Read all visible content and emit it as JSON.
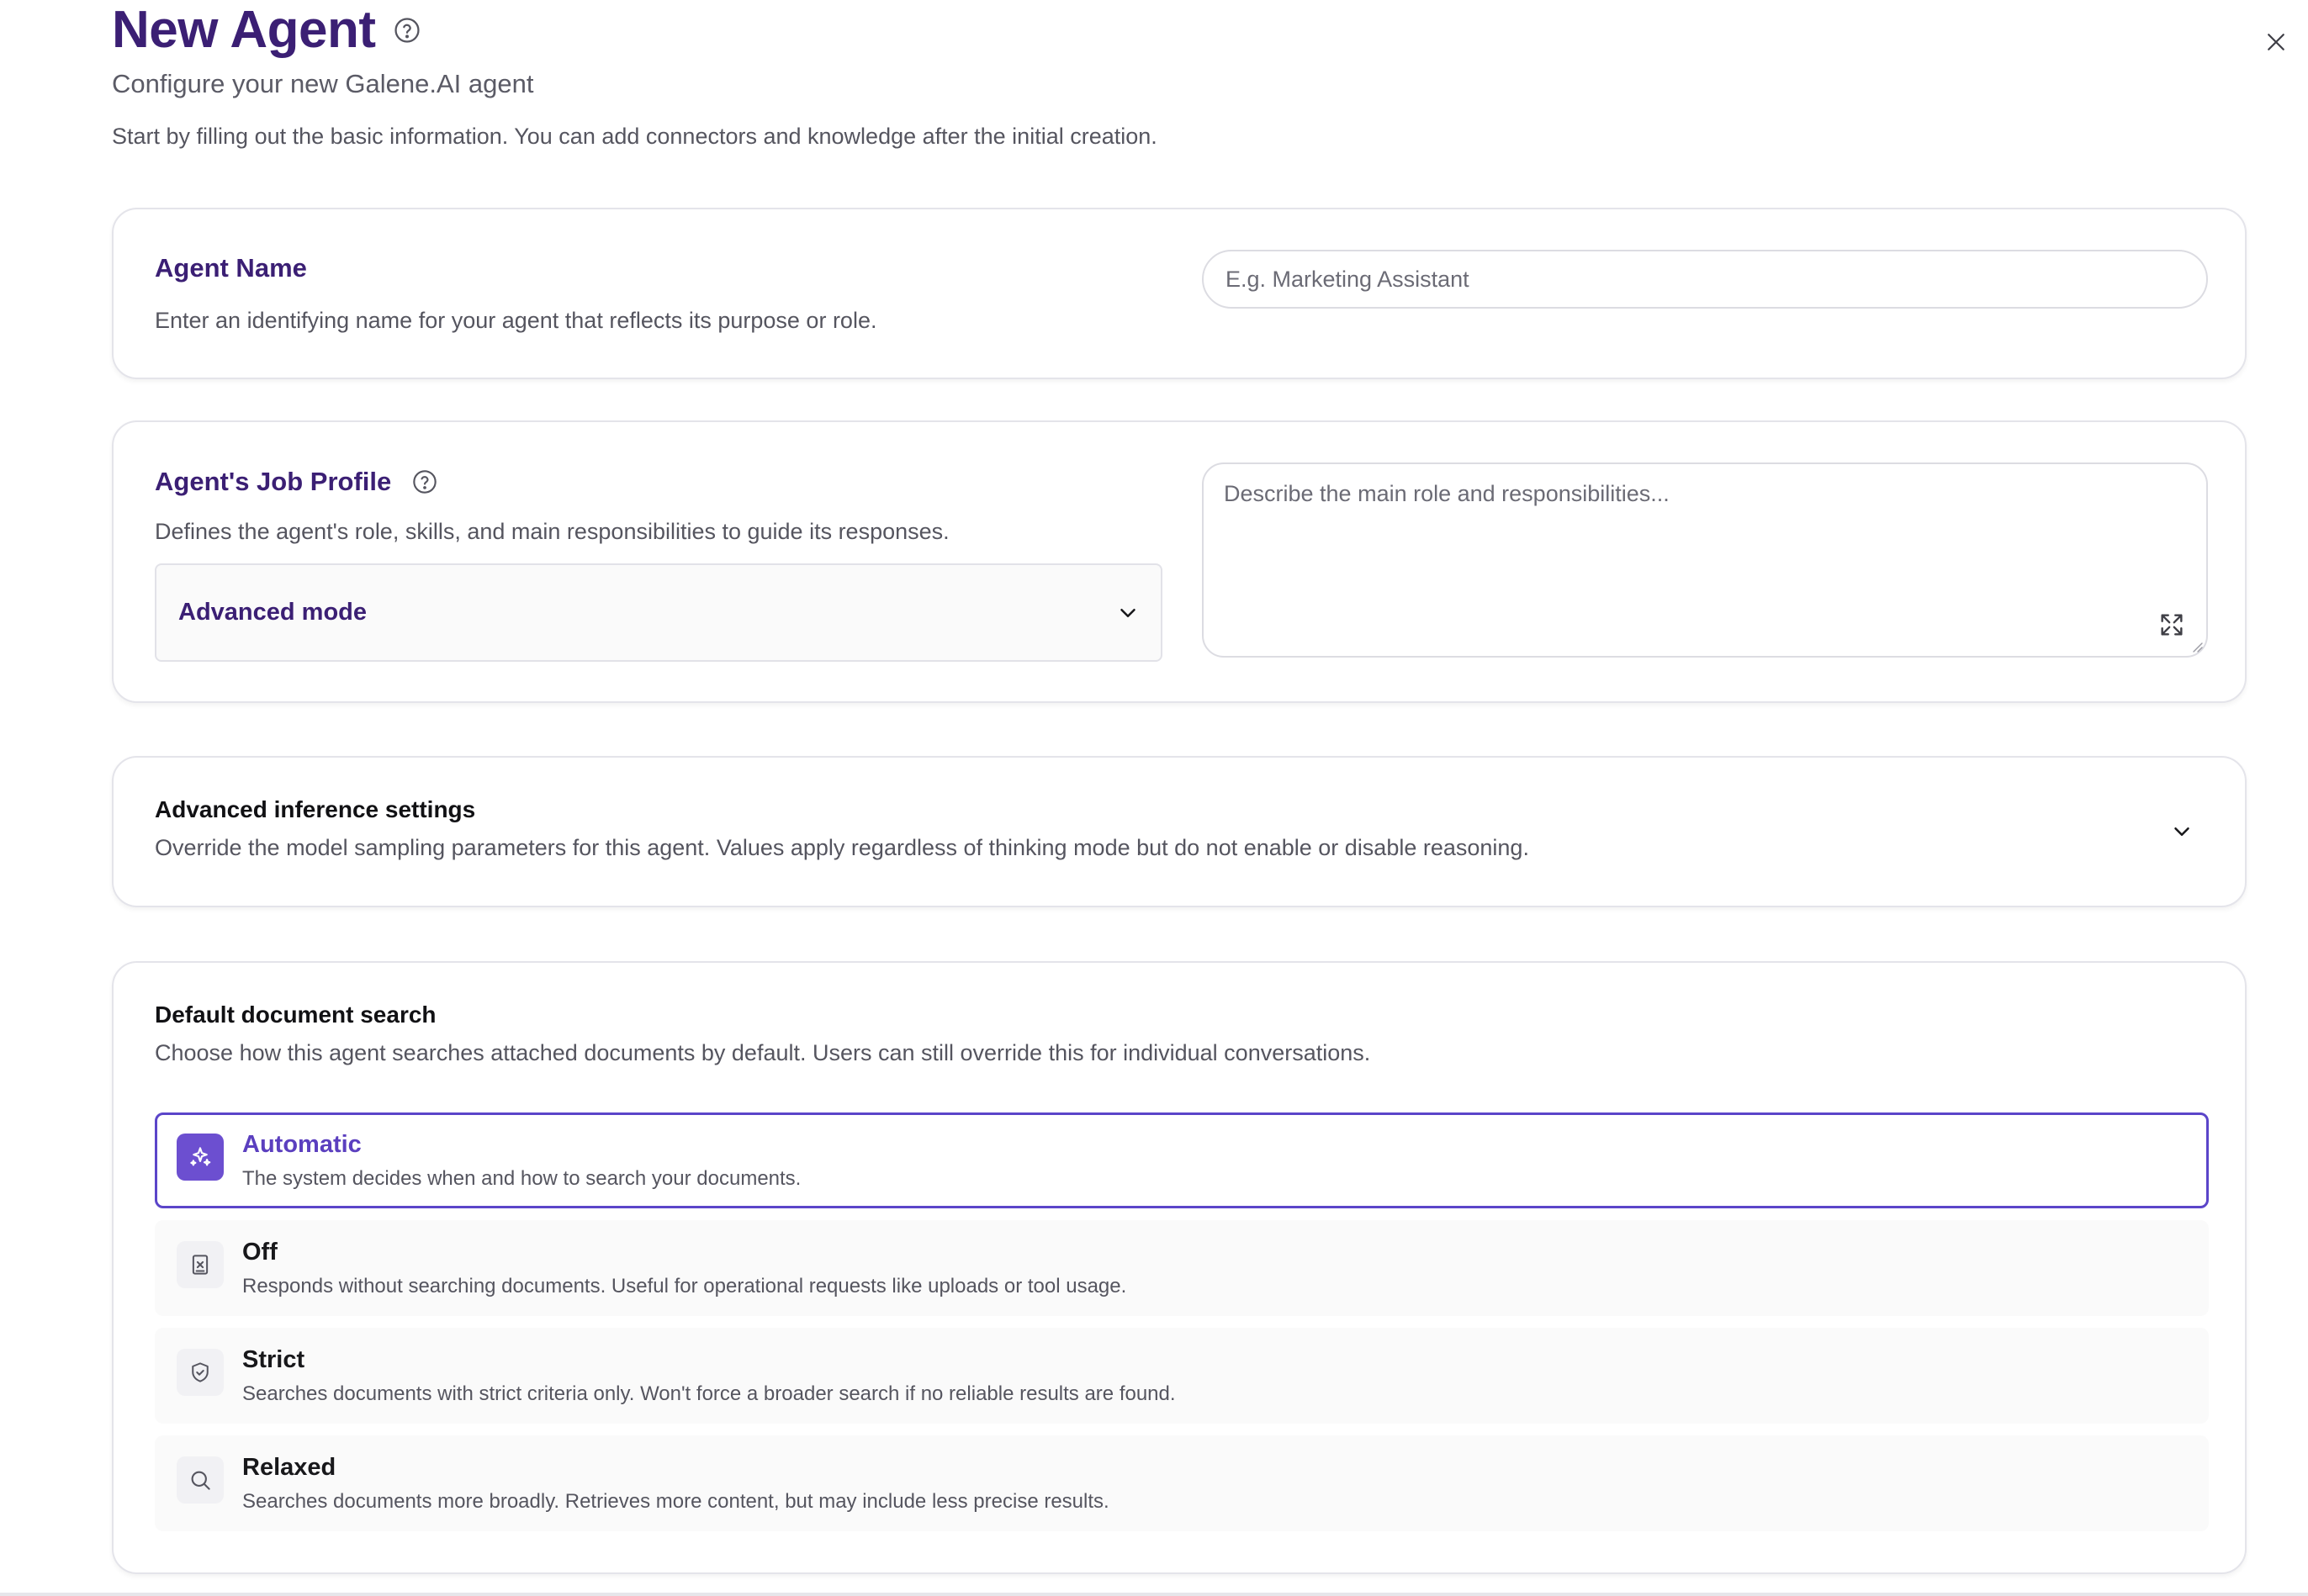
{
  "header": {
    "title": "New Agent",
    "subtitle": "Configure your new Galene.AI agent",
    "intro": "Start by filling out the basic information. You can add connectors and knowledge after the initial creation."
  },
  "agent_name": {
    "title": "Agent Name",
    "description": "Enter an identifying name for your agent that reflects its purpose or role.",
    "input_value": "",
    "input_placeholder": "E.g. Marketing Assistant"
  },
  "job_profile": {
    "title": "Agent's Job Profile",
    "description": "Defines the agent's role, skills, and main responsibilities to guide its responses.",
    "mode_selected": "Advanced mode",
    "textarea_value": "",
    "textarea_placeholder": "Describe the main role and responsibilities..."
  },
  "inference": {
    "title": "Advanced inference settings",
    "description": "Override the model sampling parameters for this agent. Values apply regardless of thinking mode but do not enable or disable reasoning.",
    "expanded": false
  },
  "document_search": {
    "title": "Default document search",
    "description": "Choose how this agent searches attached documents by default. Users can still override this for individual conversations.",
    "selected": "Automatic",
    "options": [
      {
        "title": "Automatic",
        "description": "The system decides when and how to search your documents.",
        "icon": "sparkles-icon"
      },
      {
        "title": "Off",
        "description": "Responds without searching documents. Useful for operational requests like uploads or tool usage.",
        "icon": "document-x-icon"
      },
      {
        "title": "Strict",
        "description": "Searches documents with strict criteria only. Won't force a broader search if no reliable results are found.",
        "icon": "shield-check-icon"
      },
      {
        "title": "Relaxed",
        "description": "Searches documents more broadly. Retrieves more content, but may include less precise results.",
        "icon": "search-icon"
      }
    ]
  },
  "colors": {
    "brand_dark": "#3b1f74",
    "accent": "#5b45c9",
    "selected_icon_bg": "#6c4fd0",
    "border": "#e4e4ea"
  }
}
